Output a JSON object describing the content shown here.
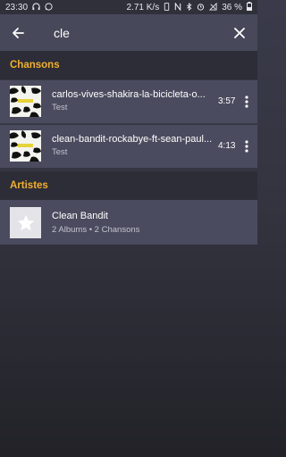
{
  "status_bar": {
    "time": "23:30",
    "speed": "2.71 K/s",
    "battery": "36 %",
    "left_icons": [
      "headphones-icon",
      "whatsapp-icon"
    ],
    "right_icons": [
      "vibrate-icon",
      "nfc-icon",
      "bluetooth-icon",
      "alarm-icon",
      "no-signal-icon",
      "battery-icon"
    ]
  },
  "search": {
    "value": "cle",
    "back_icon": "arrow-left-icon",
    "clear_icon": "close-icon"
  },
  "sections": {
    "songs_header": "Chansons",
    "artists_header": "Artistes"
  },
  "songs": [
    {
      "title": "carlos-vives-shakira-la-bicicleta-o...",
      "subtitle": "Test",
      "duration": "3:57"
    },
    {
      "title": "clean-bandit-rockabye-ft-sean-paul...",
      "subtitle": "Test",
      "duration": "4:13"
    }
  ],
  "artists": [
    {
      "name": "Clean Bandit",
      "meta": "2 Albums • 2 Chansons",
      "icon": "star-icon"
    }
  ],
  "colors": {
    "accent": "#f2b027",
    "row_bg": "#4a4b5e",
    "search_bar_bg": "#474859",
    "section_bg": "#2c2d37"
  }
}
